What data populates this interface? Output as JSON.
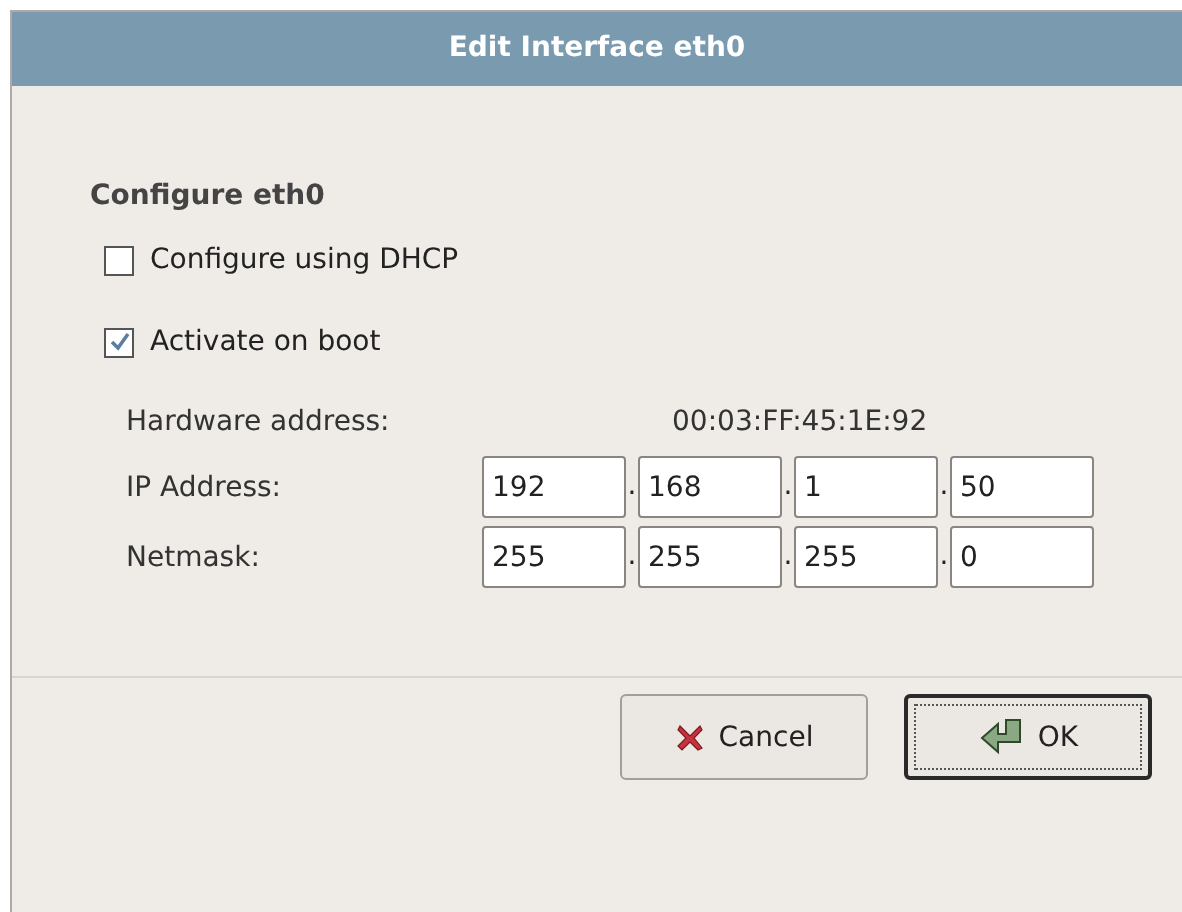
{
  "window": {
    "title": "Edit Interface eth0"
  },
  "section": {
    "title": "Configure eth0"
  },
  "options": [
    {
      "label": "Configure using DHCP",
      "checked": false
    },
    {
      "label": "Activate on boot",
      "checked": true
    }
  ],
  "hardware_address": {
    "label": "Hardware address:",
    "value": "00:03:FF:45:1E:92"
  },
  "address_rows": [
    {
      "label": "IP Address:",
      "octets": [
        "192",
        "168",
        "1",
        "50"
      ],
      "separator": "."
    },
    {
      "label": "Netmask:",
      "octets": [
        "255",
        "255",
        "255",
        "0"
      ],
      "separator": "."
    }
  ],
  "buttons": [
    {
      "kind": "cancel",
      "label": "Cancel",
      "default": false
    },
    {
      "kind": "ok",
      "label": "OK",
      "default": true
    }
  ]
}
